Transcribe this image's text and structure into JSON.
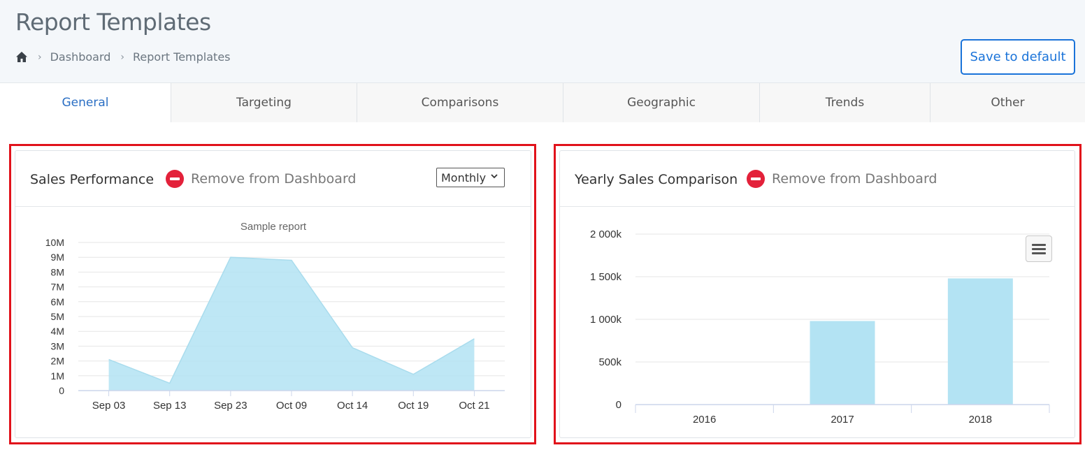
{
  "header": {
    "title": "Report Templates",
    "breadcrumb": [
      "Dashboard",
      "Report Templates"
    ],
    "save_label": "Save to default"
  },
  "tabs": [
    {
      "label": "General",
      "active": true
    },
    {
      "label": "Targeting",
      "active": false
    },
    {
      "label": "Comparisons",
      "active": false
    },
    {
      "label": "Geographic",
      "active": false
    },
    {
      "label": "Trends",
      "active": false
    },
    {
      "label": "Other",
      "active": false
    }
  ],
  "cards": {
    "sales": {
      "title": "Sales Performance",
      "remove_label": "Remove from Dashboard",
      "period": "Monthly"
    },
    "yearly": {
      "title": "Yearly Sales Comparison",
      "remove_label": "Remove from Dashboard"
    }
  },
  "colors": {
    "accent": "#1a73d9",
    "highlight": "#e1121b",
    "remove": "#e3213a",
    "series_fill": "#b3e3f3"
  },
  "chart_data": [
    {
      "type": "area",
      "title": "Sample report",
      "categories": [
        "Sep 03",
        "Sep 13",
        "Sep 23",
        "Oct 09",
        "Oct 14",
        "Oct 19",
        "Oct 21"
      ],
      "values": [
        2100000,
        500000,
        9000000,
        8800000,
        2900000,
        1100000,
        3500000
      ],
      "yticks": [
        "0",
        "1M",
        "2M",
        "3M",
        "4M",
        "5M",
        "6M",
        "7M",
        "8M",
        "9M",
        "10M"
      ],
      "ylim": [
        0,
        10000000
      ],
      "grid": true,
      "legend": false
    },
    {
      "type": "bar",
      "categories": [
        "2016",
        "2017",
        "2018"
      ],
      "values": [
        0,
        980000,
        1480000
      ],
      "yticks": [
        "0",
        "500k",
        "1 000k",
        "1 500k",
        "2 000k"
      ],
      "ylim": [
        0,
        2000000
      ],
      "grid": true,
      "legend": false
    }
  ]
}
